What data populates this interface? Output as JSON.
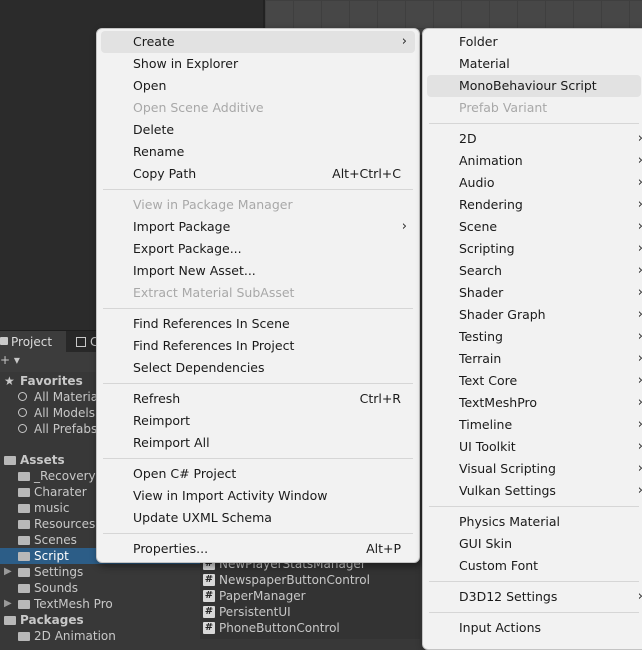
{
  "project_panel": {
    "tab_project": "Project",
    "tab_console": "C",
    "toolbar_plus": "+ ▾",
    "tree": [
      {
        "label": "Favorites",
        "bold": true,
        "kind": "star"
      },
      {
        "label": "All Materia",
        "kind": "search"
      },
      {
        "label": "All Models",
        "kind": "search"
      },
      {
        "label": "All Prefabs",
        "kind": "search"
      },
      {
        "label": "Assets",
        "bold": true,
        "kind": "folder"
      },
      {
        "label": "_Recovery",
        "kind": "folder"
      },
      {
        "label": "Charater",
        "kind": "folder"
      },
      {
        "label": "music",
        "kind": "folder"
      },
      {
        "label": "Resources",
        "kind": "folder"
      },
      {
        "label": "Scenes",
        "kind": "folder"
      },
      {
        "label": "Script",
        "kind": "folder",
        "selected": true
      },
      {
        "label": "Settings",
        "kind": "folder"
      },
      {
        "label": "Sounds",
        "kind": "folder"
      },
      {
        "label": "TextMesh Pro",
        "kind": "folder"
      },
      {
        "label": "Packages",
        "bold": true,
        "kind": "folder"
      },
      {
        "label": "2D Animation",
        "kind": "folder"
      }
    ],
    "files": [
      "NewPlayerStatsManager",
      "NewspaperButtonControl",
      "PaperManager",
      "PersistentUI",
      "PhoneButtonControl"
    ]
  },
  "context_menu": {
    "items": [
      {
        "label": "Create",
        "arrow": "›",
        "highlight": true
      },
      {
        "label": "Show in Explorer"
      },
      {
        "label": "Open"
      },
      {
        "label": "Open Scene Additive",
        "disabled": true
      },
      {
        "label": "Delete"
      },
      {
        "label": "Rename"
      },
      {
        "label": "Copy Path",
        "shortcut": "Alt+Ctrl+C"
      },
      {
        "sep": true
      },
      {
        "label": "View in Package Manager",
        "disabled": true
      },
      {
        "label": "Import Package",
        "arrow": "›"
      },
      {
        "label": "Export Package..."
      },
      {
        "label": "Import New Asset..."
      },
      {
        "label": "Extract Material SubAsset",
        "disabled": true
      },
      {
        "sep": true
      },
      {
        "label": "Find References In Scene"
      },
      {
        "label": "Find References In Project"
      },
      {
        "label": "Select Dependencies"
      },
      {
        "sep": true
      },
      {
        "label": "Refresh",
        "shortcut": "Ctrl+R"
      },
      {
        "label": "Reimport"
      },
      {
        "label": "Reimport All"
      },
      {
        "sep": true
      },
      {
        "label": "Open C# Project"
      },
      {
        "label": "View in Import Activity Window"
      },
      {
        "label": "Update UXML Schema"
      },
      {
        "sep": true
      },
      {
        "label": "Properties...",
        "shortcut": "Alt+P"
      }
    ]
  },
  "create_submenu": {
    "items": [
      {
        "label": "Folder"
      },
      {
        "label": "Material"
      },
      {
        "label": "MonoBehaviour Script",
        "highlight": true
      },
      {
        "label": "Prefab Variant",
        "disabled": true
      },
      {
        "sep": true
      },
      {
        "label": "2D",
        "arrow": "›"
      },
      {
        "label": "Animation",
        "arrow": "›"
      },
      {
        "label": "Audio",
        "arrow": "›"
      },
      {
        "label": "Rendering",
        "arrow": "›"
      },
      {
        "label": "Scene",
        "arrow": "›"
      },
      {
        "label": "Scripting",
        "arrow": "›"
      },
      {
        "label": "Search",
        "arrow": "›"
      },
      {
        "label": "Shader",
        "arrow": "›"
      },
      {
        "label": "Shader Graph",
        "arrow": "›"
      },
      {
        "label": "Testing",
        "arrow": "›"
      },
      {
        "label": "Terrain",
        "arrow": "›"
      },
      {
        "label": "Text Core",
        "arrow": "›"
      },
      {
        "label": "TextMeshPro",
        "arrow": "›"
      },
      {
        "label": "Timeline",
        "arrow": "›"
      },
      {
        "label": "UI Toolkit",
        "arrow": "›"
      },
      {
        "label": "Visual Scripting",
        "arrow": "›"
      },
      {
        "label": "Vulkan Settings",
        "arrow": "›"
      },
      {
        "sep": true
      },
      {
        "label": "Physics Material"
      },
      {
        "label": "GUI Skin"
      },
      {
        "label": "Custom Font"
      },
      {
        "sep": true
      },
      {
        "label": "D3D12 Settings",
        "arrow": "›"
      },
      {
        "sep": true
      },
      {
        "label": "Input Actions"
      }
    ]
  }
}
